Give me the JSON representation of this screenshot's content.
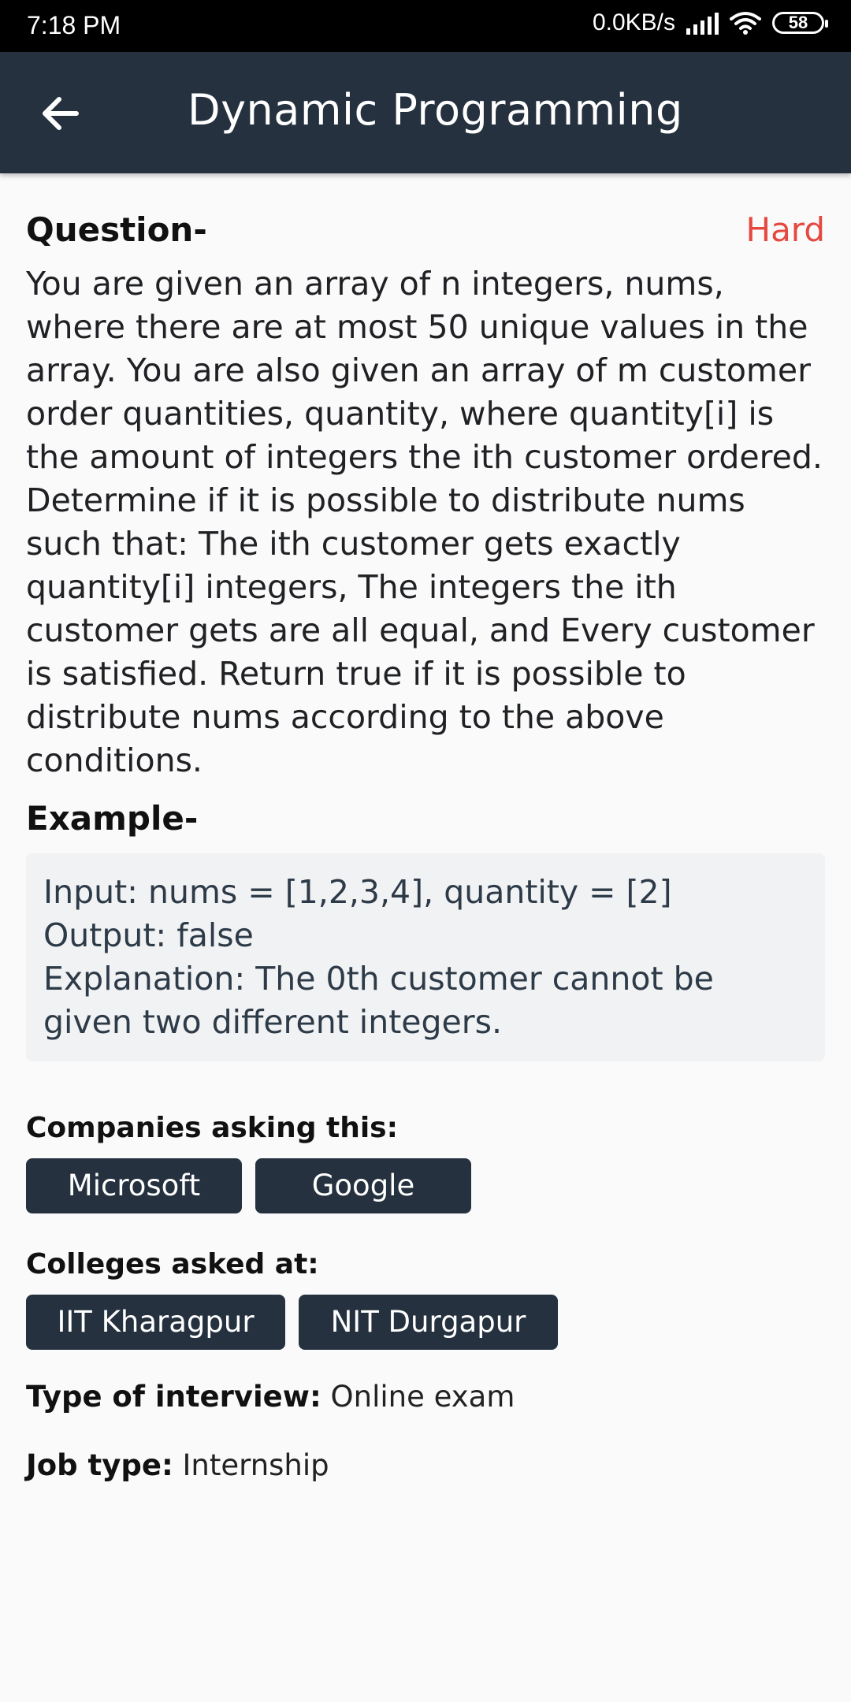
{
  "status_bar": {
    "time": "7:18 PM",
    "net_speed": "0.0KB/s",
    "battery": "58"
  },
  "app_bar": {
    "title": "Dynamic Programming",
    "back_icon": "arrow-left-icon"
  },
  "question": {
    "label": "Question-",
    "difficulty": "Hard",
    "difficulty_color": "#e5483f",
    "text": "You are given an array of n integers, nums, where there are at most 50 unique values in the array. You are also given an array of m customer order quantities, quantity, where quantity[i] is the amount of integers the ith customer ordered. Determine if it is possible to distribute nums such that: The ith customer gets exactly quantity[i] integers, The integers the ith customer gets are all equal, and Every customer is satisfied. Return true if it is possible to distribute nums according to the above conditions."
  },
  "example": {
    "label": "Example-",
    "input": "Input: nums = [1,2,3,4], quantity = [2]",
    "output": "Output: false",
    "explanation": "Explanation: The 0th customer cannot be given two different integers."
  },
  "companies": {
    "label": "Companies asking this:",
    "items": [
      "Microsoft",
      "Google"
    ]
  },
  "colleges": {
    "label": "Colleges asked at:",
    "items": [
      "IIT Kharagpur",
      "NIT Durgapur"
    ]
  },
  "interview_type": {
    "label": "Type of interview:",
    "value": "Online exam"
  },
  "job_type": {
    "label": "Job type:",
    "value": "Internship"
  },
  "colors": {
    "app_bar": "#25313f",
    "chip": "#25313f",
    "background": "#fafafa"
  }
}
